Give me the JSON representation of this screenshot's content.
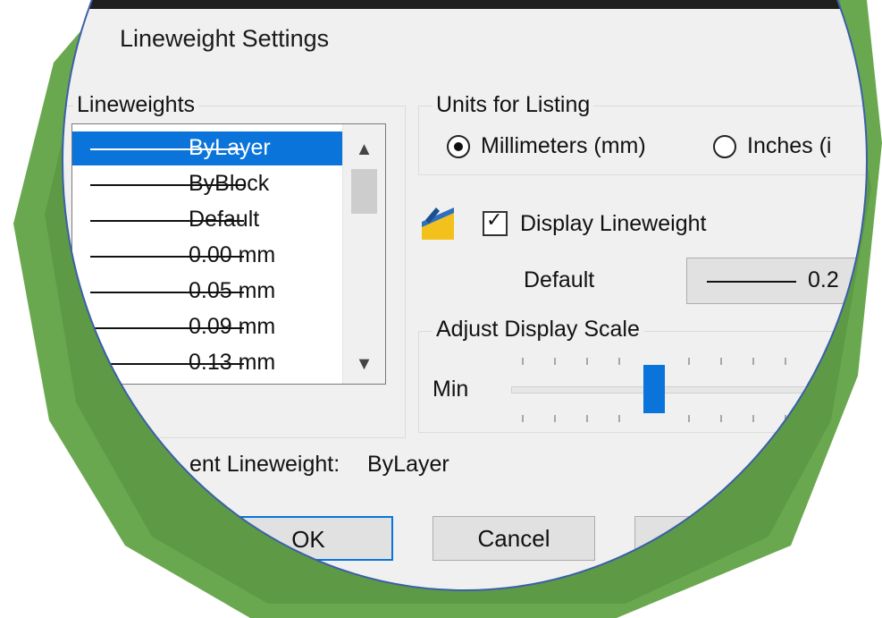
{
  "dialog": {
    "title": "Lineweight Settings",
    "lineweights_group": "Lineweights",
    "list_items": [
      {
        "label": "ByLayer",
        "selected": true
      },
      {
        "label": "ByBlock",
        "selected": false
      },
      {
        "label": "Default",
        "selected": false
      },
      {
        "label": "0.00 mm",
        "selected": false
      },
      {
        "label": "0.05 mm",
        "selected": false
      },
      {
        "label": "0.09 mm",
        "selected": false
      },
      {
        "label": "0.13 mm",
        "selected": false
      }
    ],
    "units_group": "Units for Listing",
    "units": {
      "millimeters_label": "Millimeters (mm)",
      "inches_label": "Inches (i",
      "selected": "millimeters"
    },
    "display_lineweight": {
      "label": "Display Lineweight",
      "checked": true
    },
    "default": {
      "label": "Default",
      "value_text": "0.2"
    },
    "adjust_group": "Adjust Display Scale",
    "scale": {
      "min_label": "Min"
    },
    "current": {
      "label": "ent Lineweight:",
      "value": "ByLayer"
    },
    "buttons": {
      "ok": "OK",
      "cancel": "Cancel"
    }
  },
  "colors": {
    "accent": "#0a74da",
    "frame_green": "#6aa84f",
    "frame_blue": "#3b5fa8"
  },
  "icons": {
    "scroll_up": "▲",
    "scroll_down": "▼",
    "check": "✓",
    "display_icon": "lineweight-icon"
  }
}
